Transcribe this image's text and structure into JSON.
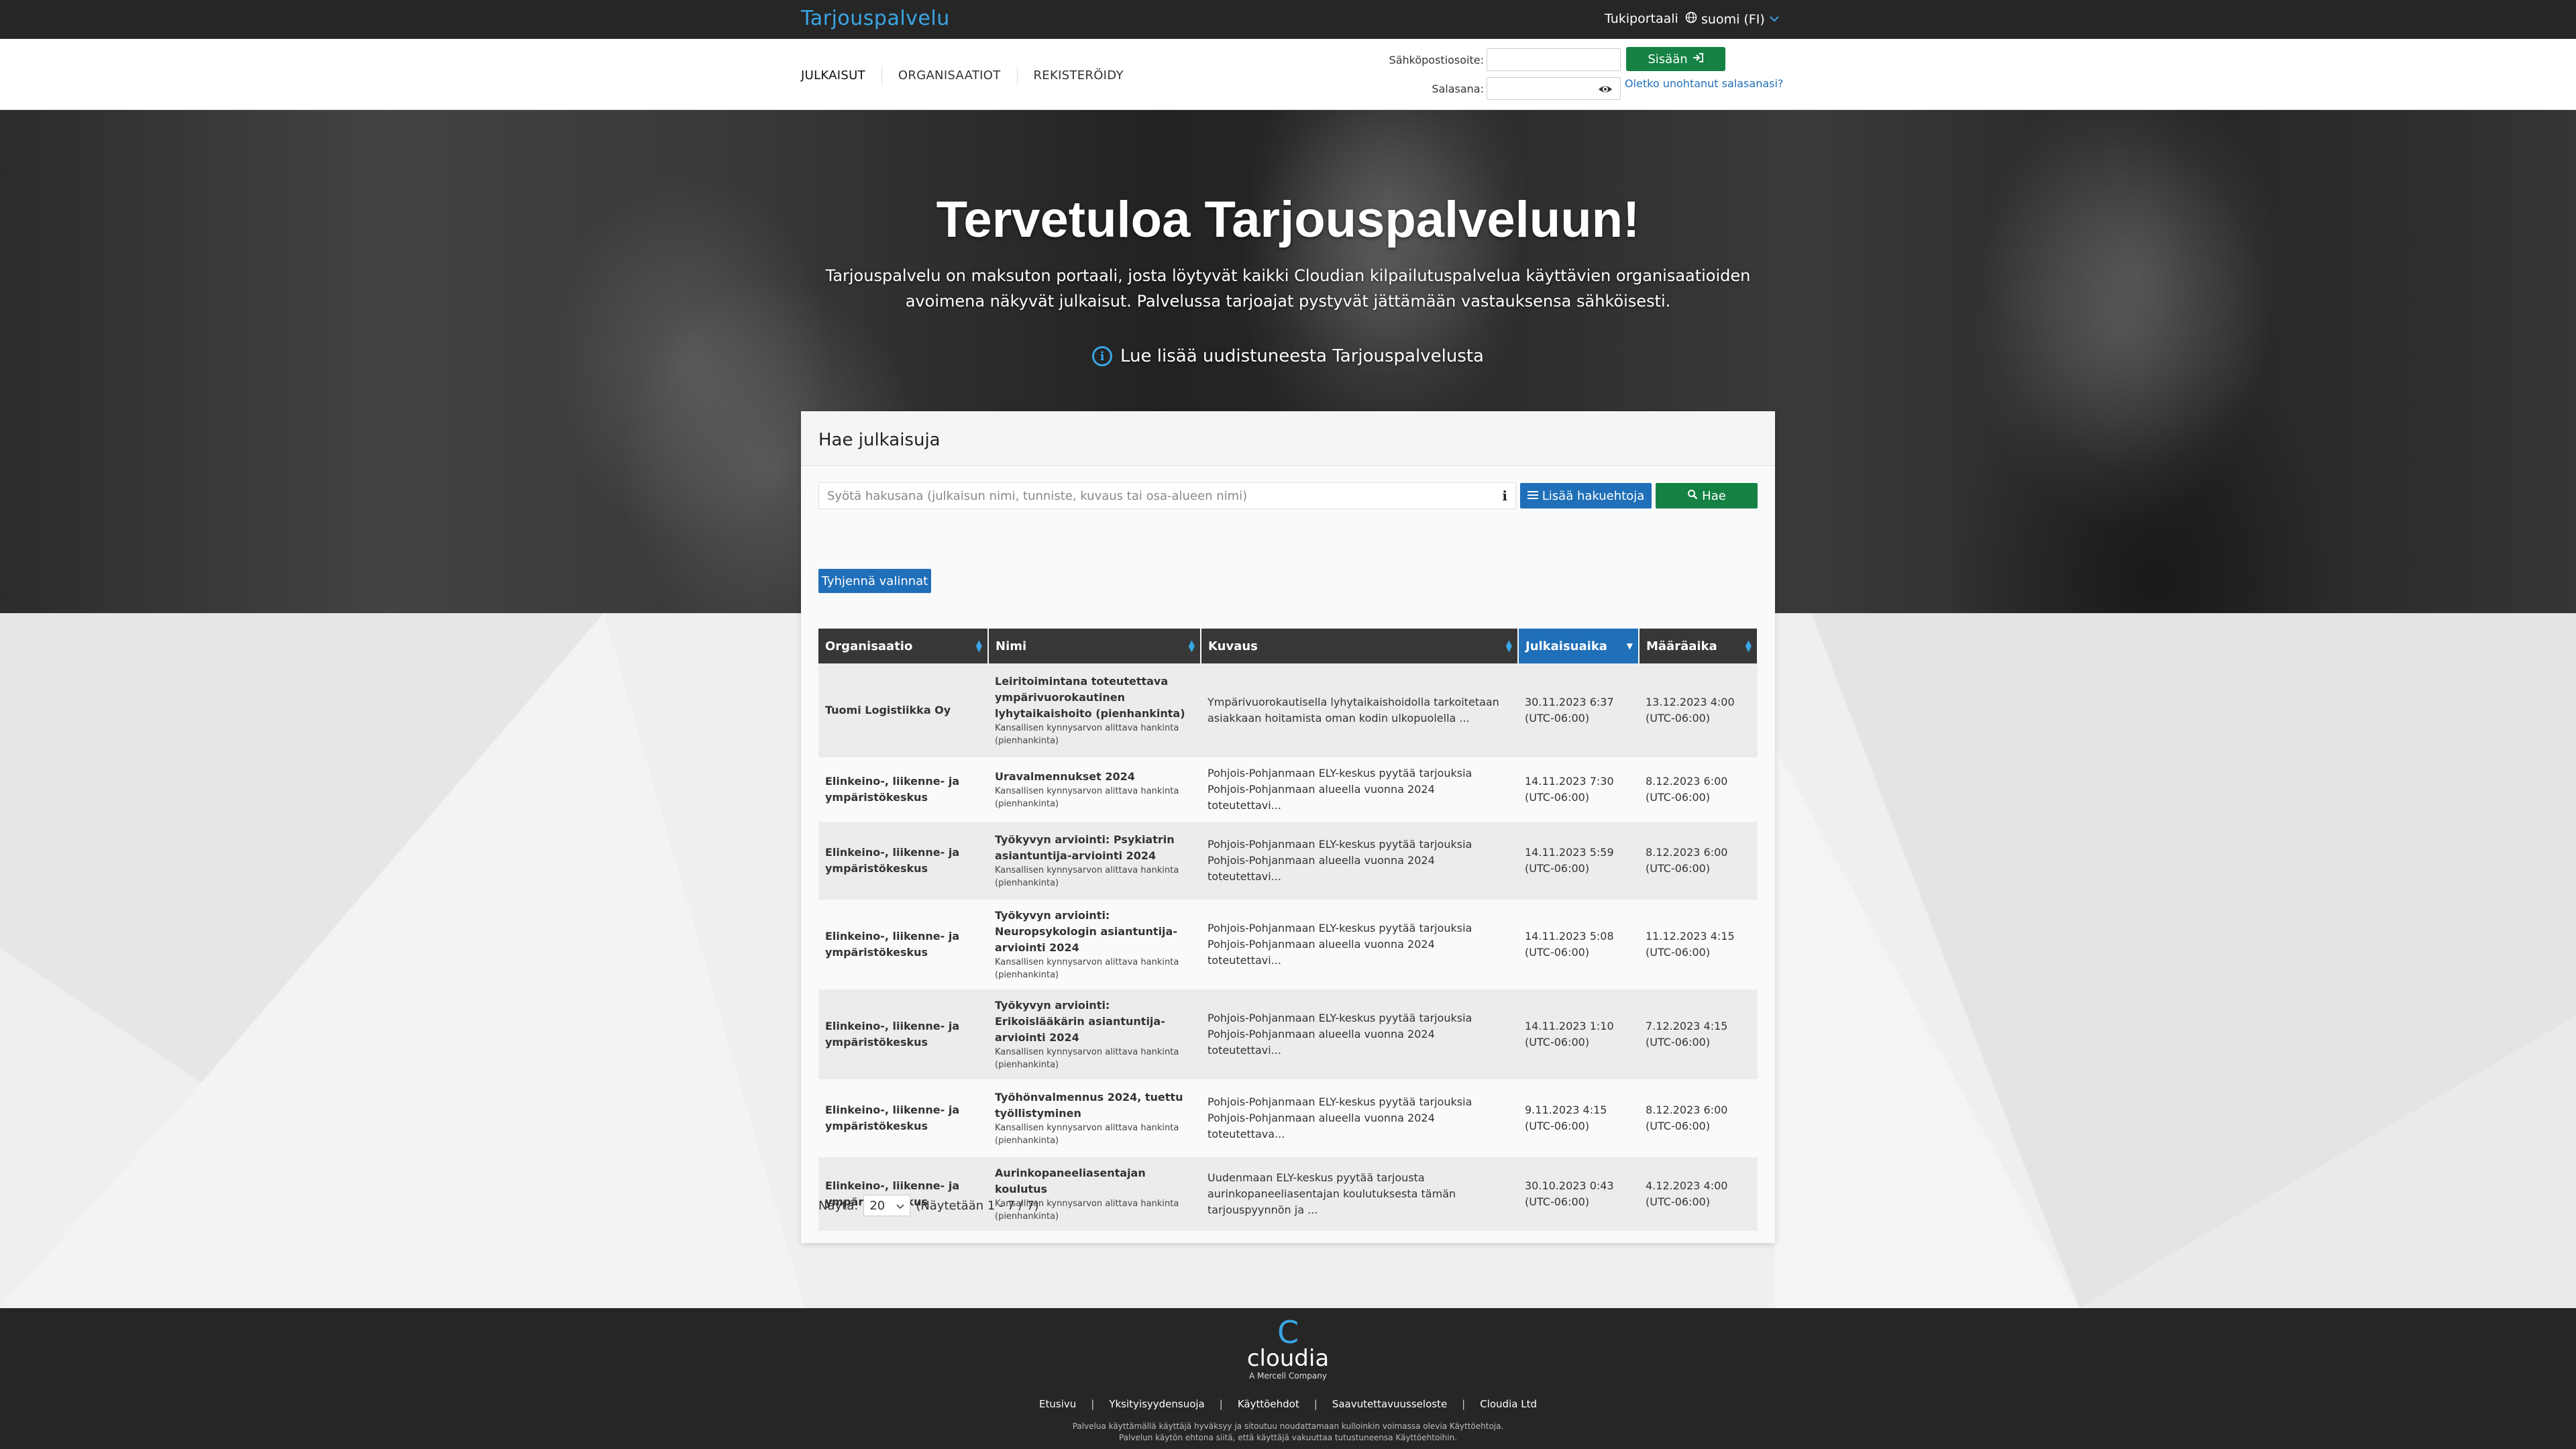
{
  "topbar": {
    "brand": "Tarjouspalvelu",
    "support": "Tukiportaali",
    "language": "suomi (FI)"
  },
  "nav": {
    "tabs": [
      "JULKAISUT",
      "ORGANISAATIOT",
      "REKISTERÖIDY"
    ]
  },
  "login": {
    "email_label": "Sähköpostiosoite:",
    "password_label": "Salasana:",
    "submit": "Sisään",
    "forgot": "Oletko unohtanut salasanasi?"
  },
  "hero": {
    "title": "Tervetuloa Tarjouspalveluun!",
    "text": "Tarjouspalvelu on maksuton portaali, josta löytyvät kaikki Cloudian kilpailutuspalvelua käyttävien organisaatioiden avoimena näkyvät julkaisut. Palvelussa tarjoajat pystyvät jättämään vastauksensa sähköisesti.",
    "info_link": "Lue lisää uudistuneesta Tarjouspalvelusta"
  },
  "search": {
    "heading": "Hae julkaisuja",
    "placeholder": "Syötä hakusana (julkaisun nimi, tunniste, kuvaus tai osa-alueen nimi)",
    "more_filters": "Lisää hakuehtoja",
    "search_button": "Hae",
    "clear_button": "Tyhjennä valinnat"
  },
  "table": {
    "headers": [
      "Organisaatio",
      "Nimi",
      "Kuvaus",
      "Julkaisuaika",
      "Määräaika"
    ],
    "rows": [
      {
        "org": "Tuomi Logistiikka Oy",
        "name": "Leiritoimintana toteutettava ympärivuorokautinen lyhytaikaishoito (pienhankinta)",
        "type": "Kansallisen kynnysarvon alittava hankinta (pienhankinta)",
        "desc": "Ympärivuorokautisella lyhytaikaishoidolla tarkoitetaan asiakkaan hoitamista oman kodin ulkopuolella ...",
        "published": "30.11.2023 6:37 (UTC-06:00)",
        "deadline": "13.12.2023 4:00 (UTC-06:00)"
      },
      {
        "org": "Elinkeino-, liikenne- ja ympäristökeskus",
        "name": "Uravalmennukset 2024",
        "type": "Kansallisen kynnysarvon alittava hankinta (pienhankinta)",
        "desc": "Pohjois-Pohjanmaan ELY-keskus pyytää tarjouksia Pohjois-Pohjanmaan alueella vuonna 2024 toteutettavi...",
        "published": "14.11.2023 7:30 (UTC-06:00)",
        "deadline": "8.12.2023 6:00 (UTC-06:00)"
      },
      {
        "org": "Elinkeino-, liikenne- ja ympäristökeskus",
        "name": "Työkyvyn arviointi: Psykiatrin asiantuntija-arviointi 2024",
        "type": "Kansallisen kynnysarvon alittava hankinta (pienhankinta)",
        "desc": "Pohjois-Pohjanmaan ELY-keskus pyytää tarjouksia Pohjois-Pohjanmaan alueella vuonna 2024 toteutettavi...",
        "published": "14.11.2023 5:59 (UTC-06:00)",
        "deadline": "8.12.2023 6:00 (UTC-06:00)"
      },
      {
        "org": "Elinkeino-, liikenne- ja ympäristökeskus",
        "name": "Työkyvyn arviointi: Neuropsykologin asiantuntija-arviointi 2024",
        "type": "Kansallisen kynnysarvon alittava hankinta (pienhankinta)",
        "desc": "Pohjois-Pohjanmaan ELY-keskus pyytää tarjouksia Pohjois-Pohjanmaan alueella vuonna 2024 toteutettavi...",
        "published": "14.11.2023 5:08 (UTC-06:00)",
        "deadline": "11.12.2023 4:15 (UTC-06:00)"
      },
      {
        "org": "Elinkeino-, liikenne- ja ympäristökeskus",
        "name": "Työkyvyn arviointi: Erikoislääkärin asiantuntija-arviointi 2024",
        "type": "Kansallisen kynnysarvon alittava hankinta (pienhankinta)",
        "desc": "Pohjois-Pohjanmaan ELY-keskus pyytää tarjouksia Pohjois-Pohjanmaan alueella vuonna 2024 toteutettavi...",
        "published": "14.11.2023 1:10 (UTC-06:00)",
        "deadline": "7.12.2023 4:15 (UTC-06:00)"
      },
      {
        "org": "Elinkeino-, liikenne- ja ympäristökeskus",
        "name": "Työhönvalmennus 2024, tuettu työllistyminen",
        "type": "Kansallisen kynnysarvon alittava hankinta (pienhankinta)",
        "desc": "Pohjois-Pohjanmaan ELY-keskus pyytää tarjouksia Pohjois-Pohjanmaan alueella vuonna 2024 toteutettava...",
        "published": "9.11.2023 4:15 (UTC-06:00)",
        "deadline": "8.12.2023 6:00 (UTC-06:00)"
      },
      {
        "org": "Elinkeino-, liikenne- ja ympäristökeskus",
        "name": "Aurinkopaneeliasentajan koulutus",
        "type": "Kansallisen kynnysarvon alittava hankinta (pienhankinta)",
        "desc": "Uudenmaan ELY-keskus pyytää tarjousta aurinkopaneeliasentajan koulutuksesta tämän tarjouspyynnön ja ...",
        "published": "30.10.2023 0:43 (UTC-06:00)",
        "deadline": "4.12.2023 4:00 (UTC-06:00)"
      }
    ]
  },
  "pager": {
    "show_label": "Näytä:",
    "page_size": "20",
    "status": "(Näytetään 1 - 7 / 7)"
  },
  "footer": {
    "logo_word": "cloudia",
    "logo_sub": "A Mercell Company",
    "links": [
      "Etusivu",
      "Yksityisyydensuoja",
      "Käyttöehdot",
      "Saavutettavuusseloste",
      "Cloudia Ltd"
    ],
    "note_line1": "Palvelua käyttämällä käyttäjä hyväksyy ja sitoutuu noudattamaan kulloinkin voimassa olevia Käyttöehtoja.",
    "note_line2": "Palvelun käytön ehtona siitä, että käyttäjä vakuuttaa tutustuneensa Käyttöehtoihin."
  },
  "colors": {
    "brand_blue": "#1f6fb9",
    "accent_cyan": "#3aa6e6",
    "green": "#158244",
    "dark": "#262626"
  }
}
